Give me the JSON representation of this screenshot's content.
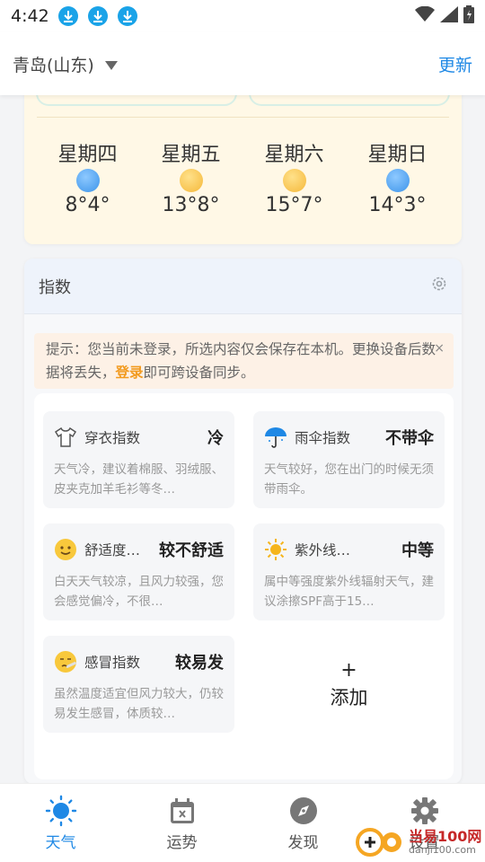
{
  "status_bar": {
    "time": "4:42",
    "download_icon_count": 3
  },
  "header": {
    "city": "青岛(山东)",
    "update_label": "更新"
  },
  "forecast": {
    "days": [
      {
        "name": "星期四",
        "icon": "overcast-icon",
        "icon_color": "#3c94ea",
        "temp": "8°4°"
      },
      {
        "name": "星期五",
        "icon": "sunny-icon",
        "icon_color": "#f5b83a",
        "temp": "13°8°"
      },
      {
        "name": "星期六",
        "icon": "sunny-icon",
        "icon_color": "#f5b83a",
        "temp": "15°7°"
      },
      {
        "name": "星期日",
        "icon": "overcast-icon",
        "icon_color": "#3c94ea",
        "temp": "14°3°"
      }
    ]
  },
  "index": {
    "title": "指数",
    "notice": {
      "text_before": "提示：您当前未登录，所选内容仅会保存在本机。更换设备后数据将丢失，",
      "login": "登录",
      "text_after": "即可跨设备同步。",
      "close": "×"
    },
    "tiles": [
      {
        "name": "穿衣指数",
        "level": "冷",
        "icon": "shirt-icon",
        "desc": "天气冷，建议着棉服、羽绒服、皮夹克加羊毛衫等冬…"
      },
      {
        "name": "雨伞指数",
        "level": "不带伞",
        "icon": "umbrella-icon",
        "desc": "天气较好，您在出门的时候无须带雨伞。"
      },
      {
        "name": "舒适度…",
        "level": "较不舒适",
        "icon": "smiley-icon",
        "desc": "白天天气较凉，且风力较强，您会感觉偏冷，不很…"
      },
      {
        "name": "紫外线…",
        "level": "中等",
        "icon": "sun-icon",
        "desc": "属中等强度紫外线辐射天气，建议涂擦SPF高于15…"
      },
      {
        "name": "感冒指数",
        "level": "较易发",
        "icon": "sick-face-icon",
        "desc": "虽然温度适宜但风力较大，仍较易发生感冒，体质较…"
      }
    ],
    "add": {
      "plus": "+",
      "label": "添加"
    }
  },
  "nav": [
    {
      "label": "天气",
      "icon": "sun-icon",
      "active": true
    },
    {
      "label": "运势",
      "icon": "calendar-icon",
      "active": false
    },
    {
      "label": "发现",
      "icon": "compass-icon",
      "active": false
    },
    {
      "label": "设置",
      "icon": "gear-icon",
      "active": false
    }
  ],
  "watermark": {
    "text": "当易100网",
    "sub": "danji100.com"
  },
  "colors": {
    "accent": "#1e88e5",
    "login": "#f29a1e",
    "forecast_bg": "#fff8e6"
  }
}
